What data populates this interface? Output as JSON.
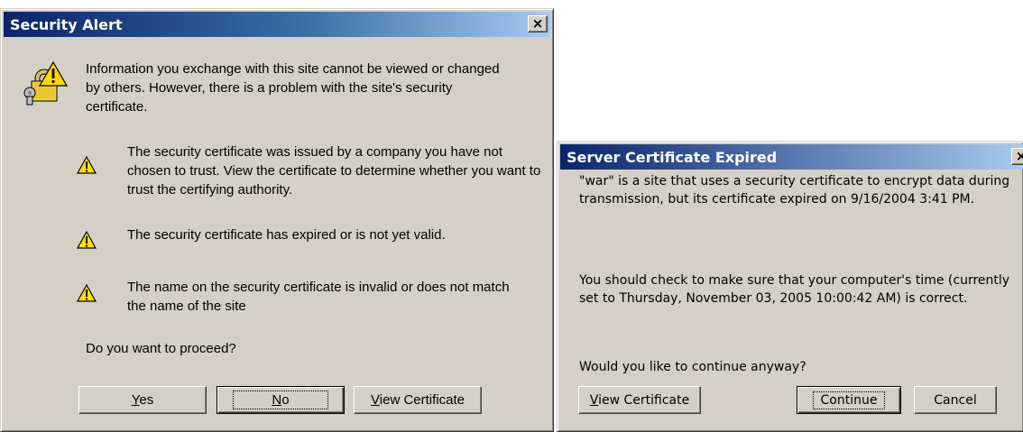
{
  "security_alert": {
    "title": "Security Alert",
    "close_label": "×",
    "intro": "Information you exchange with this site cannot be viewed or changed by others. However, there is a problem with the site's security certificate.",
    "warnings": [
      "The security certificate was issued by a company you have not chosen to trust. View the certificate to determine whether you want to trust the certifying authority.",
      "The security certificate has expired or is not yet valid.",
      "The name on the security certificate is invalid or does not match the name of the site"
    ],
    "question": "Do you want to proceed?",
    "buttons": {
      "yes_mnemonic": "Y",
      "yes_rest": "es",
      "no_mnemonic": "N",
      "no_rest": "o",
      "view_mnemonic": "V",
      "view_rest": "iew Certificate"
    },
    "icons": {
      "header": "lock-key-warning-icon",
      "warning": "warning-triangle-icon"
    }
  },
  "server_cert": {
    "title": "Server Certificate Expired",
    "close_label": "×",
    "para1": "\"war\" is a site that uses a security certificate to encrypt data during transmission, but its certificate expired on 9/16/2004 3:41 PM.",
    "para2": "You should check to make sure that your computer's time (currently set to Thursday, November 03, 2005 10:00:42 AM) is correct.",
    "question": "Would you like to continue anyway?",
    "buttons": {
      "view_mnemonic": "V",
      "view_rest": "iew Certificate",
      "continue_label": "Continue",
      "cancel_label": "Cancel"
    }
  },
  "colors": {
    "dialog_bg": "#d4d0c8",
    "title_start": "#0a246a",
    "title_end": "#a6caf0"
  }
}
